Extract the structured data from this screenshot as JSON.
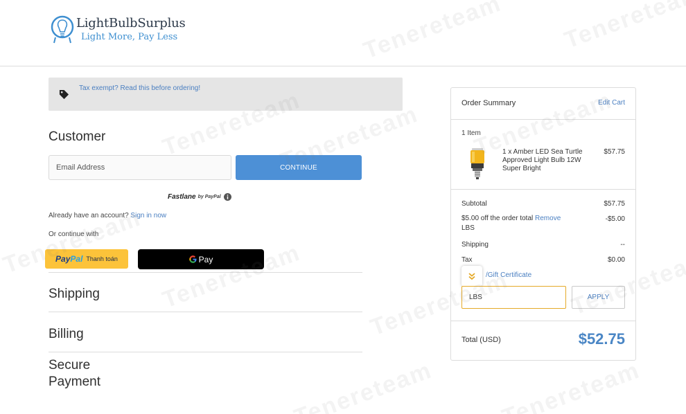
{
  "header": {
    "logo_name": "LightBulbSurplus",
    "logo_tagline": "Light More, Pay Less"
  },
  "tax_banner": {
    "text": "Tax exempt? Read this before ordering!"
  },
  "customer": {
    "title": "Customer",
    "email_placeholder": "Email Address",
    "continue_label": "CONTINUE",
    "fastlane_name": "Fastlane",
    "fastlane_by": "by PayPal",
    "account_prompt": "Already have an account?",
    "signin_label": "Sign in now",
    "or_continue": "Or continue with",
    "paypal_text": "Thanh toán",
    "paypal_brand_a": "Pay",
    "paypal_brand_b": "Pal",
    "gpay_label": "Pay"
  },
  "sections": {
    "shipping": "Shipping",
    "billing": "Billing",
    "payment": "Secure Payment"
  },
  "summary": {
    "title": "Order Summary",
    "edit_cart": "Edit Cart",
    "item_count": "1 Item",
    "product_name": "1 x Amber LED Sea Turtle Approved Light Bulb 12W Super Bright",
    "product_price": "$57.75",
    "subtotal_label": "Subtotal",
    "subtotal_value": "$57.75",
    "discount_label": "$5.00 off the order total",
    "discount_remove": "Remove",
    "discount_code": "LBS",
    "discount_value": "-$5.00",
    "shipping_label": "Shipping",
    "shipping_value": "--",
    "tax_label": "Tax",
    "tax_value": "$0.00",
    "coupon_link": "/Gift Certificate",
    "coupon_value": "LBS",
    "apply_label": "APPLY",
    "total_label": "Total (USD)",
    "total_value": "$52.75"
  },
  "watermark": {
    "text": "Tenereteam"
  },
  "colors": {
    "accent": "#4d90d6",
    "link": "#4a7fc1",
    "total": "#4a86c5",
    "paypal_yellow": "#fcc33a",
    "coupon_border": "#e5a927"
  }
}
